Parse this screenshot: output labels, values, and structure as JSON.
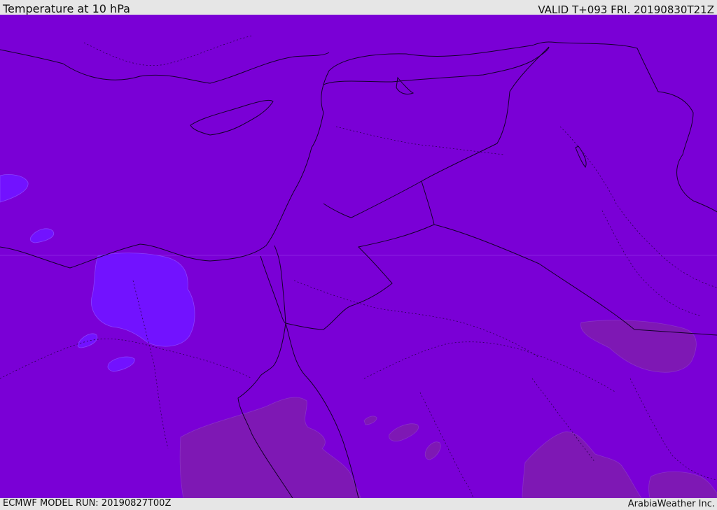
{
  "header": {
    "title": "Temperature at 10 hPa",
    "valid": "VALID T+093 FRI. 20190830T21Z"
  },
  "footer": {
    "model_run": "ECMWF MODEL RUN: 20190827T00Z",
    "credit": "ArabiaWeather Inc."
  },
  "colors": {
    "base_field": "#7a00d6",
    "cooler_patch": "#7a10ff",
    "warmer_patch": "#7e1cb0",
    "border_line": "#1a0030"
  }
}
